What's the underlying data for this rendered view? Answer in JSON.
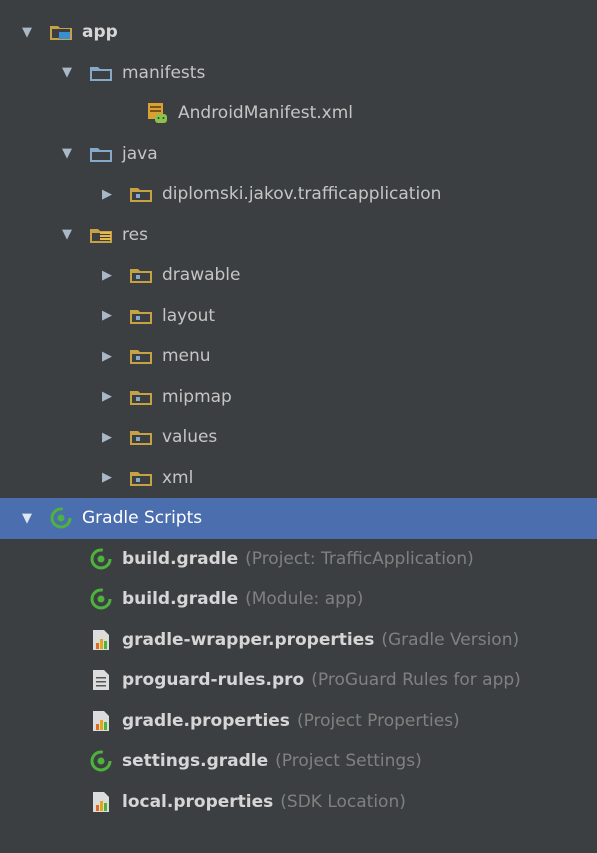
{
  "tree": {
    "app": {
      "label": "app",
      "expanded": true,
      "icon": "module-folder-icon"
    },
    "manifests": {
      "label": "manifests",
      "expanded": true,
      "icon": "folder-icon"
    },
    "android_manifest": {
      "label": "AndroidManifest.xml",
      "icon": "android-manifest-icon"
    },
    "java": {
      "label": "java",
      "expanded": true,
      "icon": "folder-icon"
    },
    "package": {
      "label": "diplomski.jakov.trafficapplication",
      "expanded": false,
      "icon": "package-icon"
    },
    "res": {
      "label": "res",
      "expanded": true,
      "icon": "resource-folder-icon"
    },
    "res_items": [
      {
        "label": "drawable"
      },
      {
        "label": "layout"
      },
      {
        "label": "menu"
      },
      {
        "label": "mipmap"
      },
      {
        "label": "values"
      },
      {
        "label": "xml"
      }
    ],
    "gradle_scripts": {
      "label": "Gradle Scripts",
      "expanded": true,
      "selected": true,
      "icon": "gradle-icon"
    },
    "gradle_files": [
      {
        "name": "build.gradle",
        "hint": "(Project: TrafficApplication)",
        "icon": "gradle-icon"
      },
      {
        "name": "build.gradle",
        "hint": "(Module: app)",
        "icon": "gradle-icon"
      },
      {
        "name": "gradle-wrapper.properties",
        "hint": "(Gradle Version)",
        "icon": "properties-file-icon"
      },
      {
        "name": "proguard-rules.pro",
        "hint": "(ProGuard Rules for app)",
        "icon": "text-file-icon"
      },
      {
        "name": "gradle.properties",
        "hint": "(Project Properties)",
        "icon": "properties-file-icon"
      },
      {
        "name": "settings.gradle",
        "hint": "(Project Settings)",
        "icon": "gradle-icon"
      },
      {
        "name": "local.properties",
        "hint": "(SDK Location)",
        "icon": "properties-file-icon"
      }
    ]
  },
  "colors": {
    "background": "#3c3f41",
    "selection": "#4b6eaf",
    "folder": "#87a9c9",
    "gradle_green": "#4db33d",
    "hint": "#808080"
  }
}
